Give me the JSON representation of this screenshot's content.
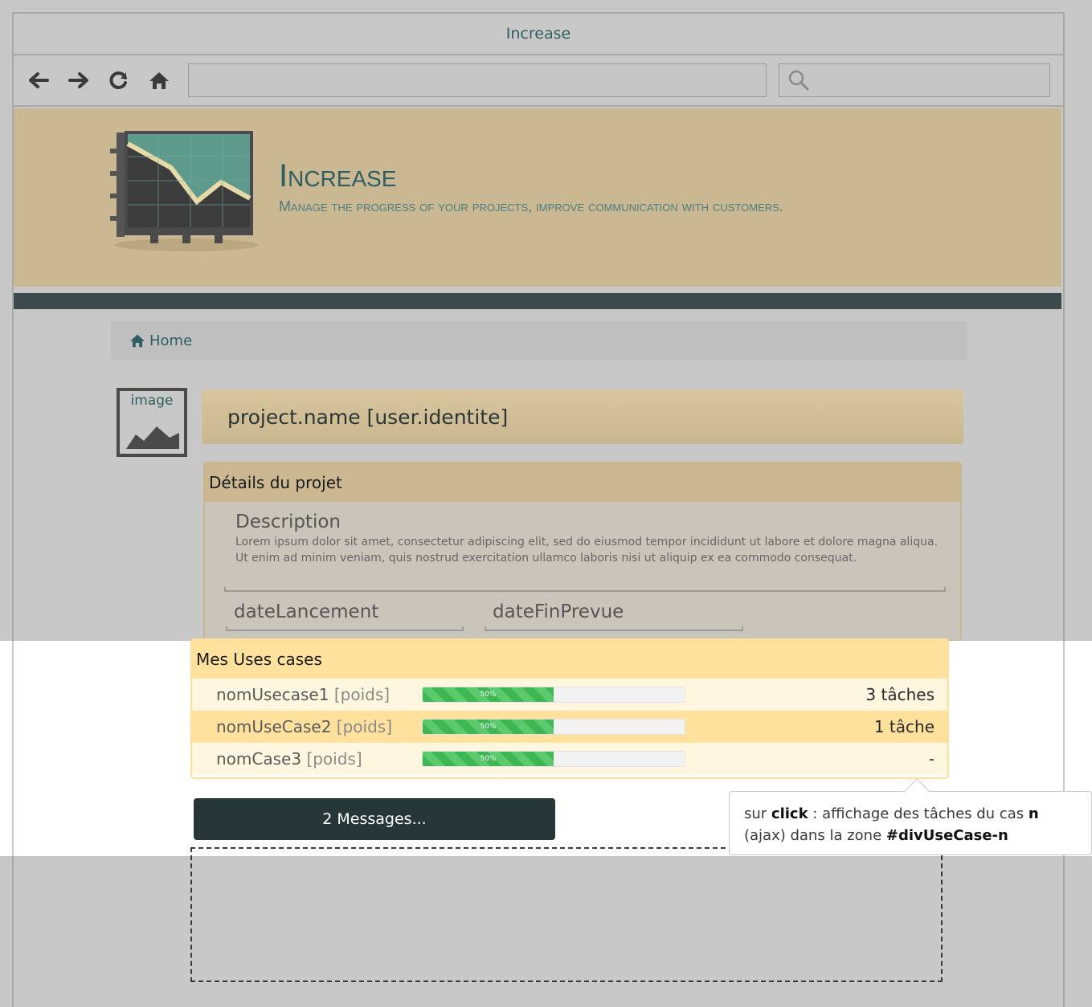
{
  "window": {
    "title": "Increase"
  },
  "browser": {
    "url": "",
    "search_placeholder": ""
  },
  "brand": {
    "title": "Increase",
    "subtitle": "Manage the progress of your projects, improve communication with customers."
  },
  "breadcrumb": {
    "home_label": "Home"
  },
  "image_placeholder": {
    "label": "image"
  },
  "project": {
    "header": "project.name [user.identite]"
  },
  "details": {
    "title": "Détails du projet",
    "description_label": "Description",
    "description_text": "Lorem ipsum dolor sit amet, consectetur adipiscing elit, sed do eiusmod tempor incididunt ut labore et dolore magna aliqua. Ut enim ad minim veniam, quis nostrud exercitation ullamco laboris nisi ut aliquip ex ea commodo consequat.",
    "date_start_label": "dateLancement",
    "date_end_label": "dateFinPrevue"
  },
  "usecases": {
    "title": "Mes Uses cases",
    "rows": [
      {
        "name": "nomUsecase1",
        "poids": "[poids]",
        "progress": 50,
        "progress_label": "50%",
        "count": "3 tâches"
      },
      {
        "name": "nomUseCase2",
        "poids": "[poids]",
        "progress": 50,
        "progress_label": "50%",
        "count": "1 tâche"
      },
      {
        "name": "nomCase3",
        "poids": "[poids]",
        "progress": 50,
        "progress_label": "50%",
        "count": "-"
      }
    ]
  },
  "messages_button": {
    "label": "2 Messages..."
  },
  "tooltip": {
    "part1": "sur ",
    "click": "click",
    "part2": " : affichage des tâches du cas ",
    "n": "n",
    "part3": "(ajax) dans la zone ",
    "zone": "#divUseCase-n"
  },
  "colors": {
    "accent": "#2e5e63",
    "banner": "#c9b891",
    "dark_bar": "#3a4a4a",
    "progress_green": "#3fb654",
    "usecase_header": "#ffe19e"
  },
  "icons": [
    "back-arrow-icon",
    "forward-arrow-icon",
    "reload-icon",
    "home-icon",
    "search-icon",
    "chart-logo-icon",
    "image-icon"
  ]
}
